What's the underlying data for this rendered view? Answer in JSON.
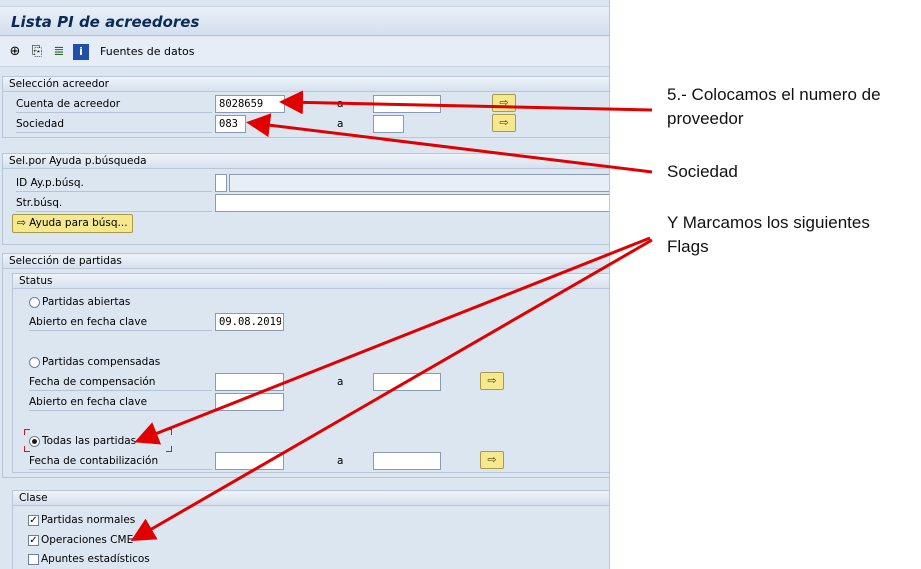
{
  "window": {
    "title": "Lista PI de acreedores"
  },
  "toolbar": {
    "icons": [
      "execute-icon",
      "variant-icon",
      "selection-options-icon",
      "info-icon"
    ],
    "data_sources_label": "Fuentes de datos"
  },
  "vendor_selection": {
    "title": "Selección acreedor",
    "account_label": "Cuenta de acreedor",
    "account_value": "8028659",
    "account_to_label": "a",
    "account_to_value": "",
    "company_label": "Sociedad",
    "company_value": "083",
    "company_to_label": "a",
    "company_to_value": ""
  },
  "search_help": {
    "title": "Sel.por Ayuda p.búsqueda",
    "id_label": "ID Ay.p.búsq.",
    "id_value": "",
    "string_label": "Str.búsq.",
    "string_value": "",
    "button_label": "Ayuda para búsq..."
  },
  "items": {
    "title": "Selección de partidas",
    "status_title": "Status",
    "open_items_label": "Partidas abiertas",
    "open_key_date_label": "Abierto en fecha clave",
    "open_key_date_value": "09.08.2019",
    "cleared_items_label": "Partidas compensadas",
    "clearing_date_label": "Fecha de compensación",
    "clearing_to_label": "a",
    "cleared_key_date_label": "Abierto en fecha clave",
    "all_items_label": "Todas las partidas",
    "posting_date_label": "Fecha de contabilización",
    "posting_to_label": "a",
    "selected_status": "all_items"
  },
  "type": {
    "title": "Clase",
    "normal_items_label": "Partidas normales",
    "normal_items_checked": true,
    "special_gl_label": "Operaciones CME",
    "special_gl_checked": true,
    "statistical_label": "Apuntes estadísticos",
    "statistical_checked": false
  },
  "annotations": {
    "step5": "5.- Colocamos el numero de proveedor",
    "company": "Sociedad",
    "flags": "Y Marcamos los siguientes Flags"
  },
  "colors": {
    "arrow": "#e00000",
    "sap_bg": "#dce6f1",
    "title_text": "#0b2a56",
    "button_yellow": "#f6e88f"
  }
}
